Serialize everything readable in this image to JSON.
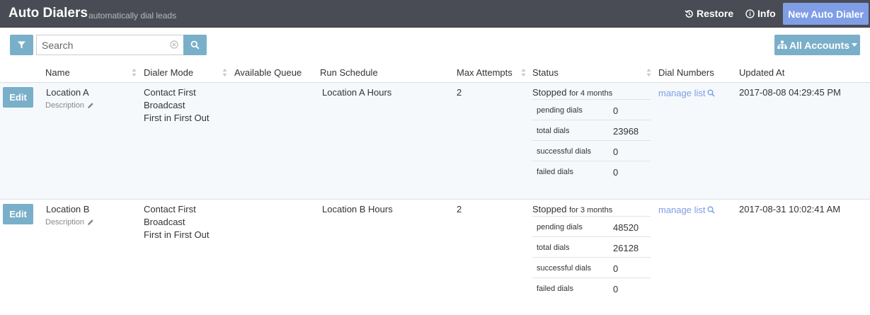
{
  "header": {
    "title": "Auto Dialers",
    "subtitle": "automatically dial leads",
    "restore_label": "Restore",
    "info_label": "Info",
    "new_label": "New Auto Dialer"
  },
  "toolbar": {
    "search_placeholder": "Search",
    "accounts_label": "All Accounts"
  },
  "columns": [
    "Name",
    "Dialer Mode",
    "Available Queue",
    "Run Schedule",
    "Max Attempts",
    "Status",
    "Dial Numbers",
    "Updated At"
  ],
  "rows": [
    {
      "edit_label": "Edit",
      "name": "Location A",
      "description": "Description",
      "modes": [
        "Contact First",
        "Broadcast",
        "First in First Out"
      ],
      "queue": "",
      "schedule": "Location A Hours",
      "max_attempts": "2",
      "status": "Stopped",
      "status_age": "for 4 months",
      "stats": [
        {
          "label": "pending dials",
          "value": "0"
        },
        {
          "label": "total dials",
          "value": "23968"
        },
        {
          "label": "successful dials",
          "value": "0"
        },
        {
          "label": "failed dials",
          "value": "0"
        }
      ],
      "manage_label": "manage list",
      "updated_at": "2017-08-08 04:29:45 PM"
    },
    {
      "edit_label": "Edit",
      "name": "Location B",
      "description": "Description",
      "modes": [
        "Contact First",
        "Broadcast",
        "First in First Out"
      ],
      "queue": "",
      "schedule": "Location B Hours",
      "max_attempts": "2",
      "status": "Stopped",
      "status_age": "for 3 months",
      "stats": [
        {
          "label": "pending dials",
          "value": "48520"
        },
        {
          "label": "total dials",
          "value": "26128"
        },
        {
          "label": "successful dials",
          "value": "0"
        },
        {
          "label": "failed dials",
          "value": "0"
        }
      ],
      "manage_label": "manage list",
      "updated_at": "2017-08-31 10:02:41 AM"
    }
  ],
  "colors": {
    "header_bg": "#4a4c55",
    "accent_blue": "#7aafc9",
    "primary_button": "#7f9ee6",
    "link": "#7f9ee6",
    "row_highlight": "#f5f9fc"
  }
}
